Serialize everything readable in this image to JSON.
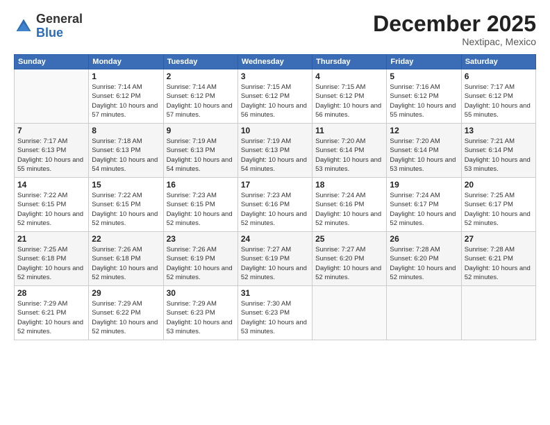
{
  "logo": {
    "general": "General",
    "blue": "Blue"
  },
  "header": {
    "month": "December 2025",
    "location": "Nextipac, Mexico"
  },
  "weekdays": [
    "Sunday",
    "Monday",
    "Tuesday",
    "Wednesday",
    "Thursday",
    "Friday",
    "Saturday"
  ],
  "weeks": [
    [
      {
        "day": "",
        "sunrise": "",
        "sunset": "",
        "daylight": "",
        "empty": true
      },
      {
        "day": "1",
        "sunrise": "Sunrise: 7:14 AM",
        "sunset": "Sunset: 6:12 PM",
        "daylight": "Daylight: 10 hours and 57 minutes."
      },
      {
        "day": "2",
        "sunrise": "Sunrise: 7:14 AM",
        "sunset": "Sunset: 6:12 PM",
        "daylight": "Daylight: 10 hours and 57 minutes."
      },
      {
        "day": "3",
        "sunrise": "Sunrise: 7:15 AM",
        "sunset": "Sunset: 6:12 PM",
        "daylight": "Daylight: 10 hours and 56 minutes."
      },
      {
        "day": "4",
        "sunrise": "Sunrise: 7:15 AM",
        "sunset": "Sunset: 6:12 PM",
        "daylight": "Daylight: 10 hours and 56 minutes."
      },
      {
        "day": "5",
        "sunrise": "Sunrise: 7:16 AM",
        "sunset": "Sunset: 6:12 PM",
        "daylight": "Daylight: 10 hours and 55 minutes."
      },
      {
        "day": "6",
        "sunrise": "Sunrise: 7:17 AM",
        "sunset": "Sunset: 6:12 PM",
        "daylight": "Daylight: 10 hours and 55 minutes."
      }
    ],
    [
      {
        "day": "7",
        "sunrise": "Sunrise: 7:17 AM",
        "sunset": "Sunset: 6:13 PM",
        "daylight": "Daylight: 10 hours and 55 minutes."
      },
      {
        "day": "8",
        "sunrise": "Sunrise: 7:18 AM",
        "sunset": "Sunset: 6:13 PM",
        "daylight": "Daylight: 10 hours and 54 minutes."
      },
      {
        "day": "9",
        "sunrise": "Sunrise: 7:19 AM",
        "sunset": "Sunset: 6:13 PM",
        "daylight": "Daylight: 10 hours and 54 minutes."
      },
      {
        "day": "10",
        "sunrise": "Sunrise: 7:19 AM",
        "sunset": "Sunset: 6:13 PM",
        "daylight": "Daylight: 10 hours and 54 minutes."
      },
      {
        "day": "11",
        "sunrise": "Sunrise: 7:20 AM",
        "sunset": "Sunset: 6:14 PM",
        "daylight": "Daylight: 10 hours and 53 minutes."
      },
      {
        "day": "12",
        "sunrise": "Sunrise: 7:20 AM",
        "sunset": "Sunset: 6:14 PM",
        "daylight": "Daylight: 10 hours and 53 minutes."
      },
      {
        "day": "13",
        "sunrise": "Sunrise: 7:21 AM",
        "sunset": "Sunset: 6:14 PM",
        "daylight": "Daylight: 10 hours and 53 minutes."
      }
    ],
    [
      {
        "day": "14",
        "sunrise": "Sunrise: 7:22 AM",
        "sunset": "Sunset: 6:15 PM",
        "daylight": "Daylight: 10 hours and 52 minutes."
      },
      {
        "day": "15",
        "sunrise": "Sunrise: 7:22 AM",
        "sunset": "Sunset: 6:15 PM",
        "daylight": "Daylight: 10 hours and 52 minutes."
      },
      {
        "day": "16",
        "sunrise": "Sunrise: 7:23 AM",
        "sunset": "Sunset: 6:15 PM",
        "daylight": "Daylight: 10 hours and 52 minutes."
      },
      {
        "day": "17",
        "sunrise": "Sunrise: 7:23 AM",
        "sunset": "Sunset: 6:16 PM",
        "daylight": "Daylight: 10 hours and 52 minutes."
      },
      {
        "day": "18",
        "sunrise": "Sunrise: 7:24 AM",
        "sunset": "Sunset: 6:16 PM",
        "daylight": "Daylight: 10 hours and 52 minutes."
      },
      {
        "day": "19",
        "sunrise": "Sunrise: 7:24 AM",
        "sunset": "Sunset: 6:17 PM",
        "daylight": "Daylight: 10 hours and 52 minutes."
      },
      {
        "day": "20",
        "sunrise": "Sunrise: 7:25 AM",
        "sunset": "Sunset: 6:17 PM",
        "daylight": "Daylight: 10 hours and 52 minutes."
      }
    ],
    [
      {
        "day": "21",
        "sunrise": "Sunrise: 7:25 AM",
        "sunset": "Sunset: 6:18 PM",
        "daylight": "Daylight: 10 hours and 52 minutes."
      },
      {
        "day": "22",
        "sunrise": "Sunrise: 7:26 AM",
        "sunset": "Sunset: 6:18 PM",
        "daylight": "Daylight: 10 hours and 52 minutes."
      },
      {
        "day": "23",
        "sunrise": "Sunrise: 7:26 AM",
        "sunset": "Sunset: 6:19 PM",
        "daylight": "Daylight: 10 hours and 52 minutes."
      },
      {
        "day": "24",
        "sunrise": "Sunrise: 7:27 AM",
        "sunset": "Sunset: 6:19 PM",
        "daylight": "Daylight: 10 hours and 52 minutes."
      },
      {
        "day": "25",
        "sunrise": "Sunrise: 7:27 AM",
        "sunset": "Sunset: 6:20 PM",
        "daylight": "Daylight: 10 hours and 52 minutes."
      },
      {
        "day": "26",
        "sunrise": "Sunrise: 7:28 AM",
        "sunset": "Sunset: 6:20 PM",
        "daylight": "Daylight: 10 hours and 52 minutes."
      },
      {
        "day": "27",
        "sunrise": "Sunrise: 7:28 AM",
        "sunset": "Sunset: 6:21 PM",
        "daylight": "Daylight: 10 hours and 52 minutes."
      }
    ],
    [
      {
        "day": "28",
        "sunrise": "Sunrise: 7:29 AM",
        "sunset": "Sunset: 6:21 PM",
        "daylight": "Daylight: 10 hours and 52 minutes."
      },
      {
        "day": "29",
        "sunrise": "Sunrise: 7:29 AM",
        "sunset": "Sunset: 6:22 PM",
        "daylight": "Daylight: 10 hours and 52 minutes."
      },
      {
        "day": "30",
        "sunrise": "Sunrise: 7:29 AM",
        "sunset": "Sunset: 6:23 PM",
        "daylight": "Daylight: 10 hours and 53 minutes."
      },
      {
        "day": "31",
        "sunrise": "Sunrise: 7:30 AM",
        "sunset": "Sunset: 6:23 PM",
        "daylight": "Daylight: 10 hours and 53 minutes."
      },
      {
        "day": "",
        "sunrise": "",
        "sunset": "",
        "daylight": "",
        "empty": true
      },
      {
        "day": "",
        "sunrise": "",
        "sunset": "",
        "daylight": "",
        "empty": true
      },
      {
        "day": "",
        "sunrise": "",
        "sunset": "",
        "daylight": "",
        "empty": true
      }
    ]
  ]
}
